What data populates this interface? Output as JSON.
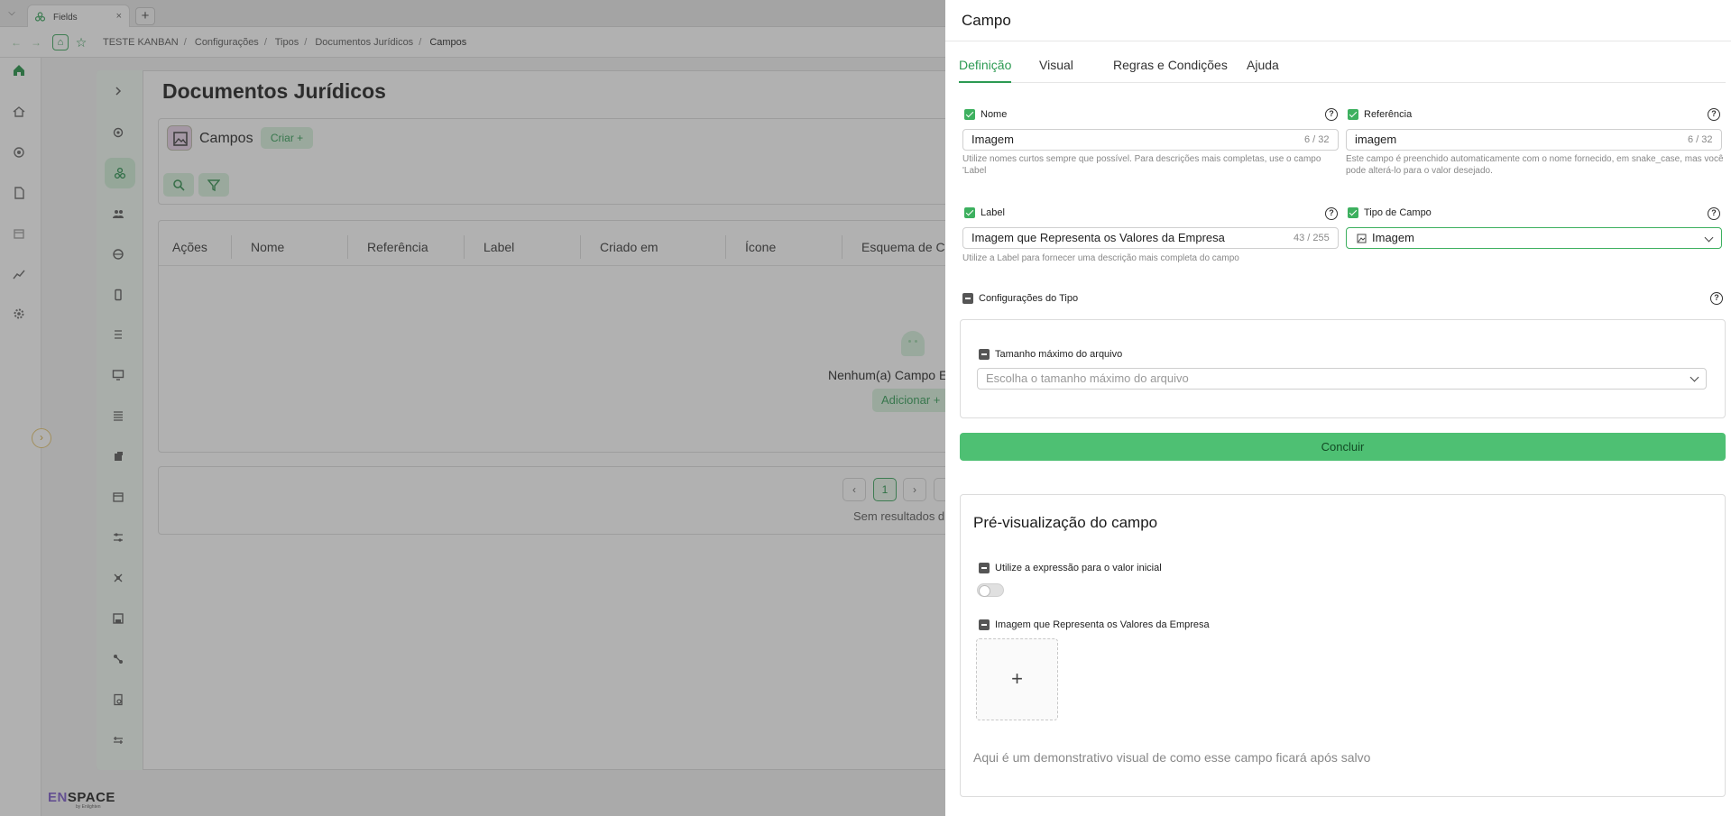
{
  "browser": {
    "tab_title": "Fields",
    "new_tab_symbol": "+",
    "breadcrumb": [
      "TESTE KANBAN",
      "Configurações",
      "Tipos",
      "Documentos Jurídicos",
      "Campos"
    ]
  },
  "app": {
    "rail_icons": [
      "home-icon",
      "house-icon",
      "settings-cog-icon",
      "document-icon",
      "calendar-icon",
      "chart-icon",
      "gear-icon"
    ],
    "brand": {
      "prefix": "EN",
      "suffix": "SPACE",
      "sub": "by Enlighten"
    },
    "accent_color": "#3db05f"
  },
  "page": {
    "title": "Documentos Jurídicos",
    "section_title": "Campos",
    "create_label": "Criar +",
    "inner_rail_icons": [
      "chevron-right-icon",
      "gear-icon",
      "fields-icon",
      "users-icon",
      "globe-icon",
      "phone-icon",
      "list-icon",
      "monitor-icon",
      "menu-icon",
      "stack-icon",
      "calendar-icon",
      "sliders-icon",
      "network-icon",
      "save-icon",
      "connection-icon",
      "report-icon",
      "tools-icon"
    ],
    "table_headers": [
      "Ações",
      "Nome",
      "Referência",
      "Label",
      "Criado em",
      "Ícone",
      "Esquema de C..."
    ],
    "empty_text": "Nenhum(a) Campo Enc",
    "add_label": "Adicionar +",
    "pagination": {
      "current_page": "1",
      "no_results": "Sem resultados d"
    }
  },
  "drawer": {
    "title": "Campo",
    "tabs": [
      "Definição",
      "Visual",
      "Regras e Condições",
      "Ajuda"
    ],
    "active_tab": "Definição",
    "fields": {
      "nome": {
        "label": "Nome",
        "value": "Imagem",
        "counter": "6 / 32",
        "hint": "Utilize nomes curtos sempre que possível. Para descrições mais completas, use o campo 'Label"
      },
      "referencia": {
        "label": "Referência",
        "value": "imagem",
        "counter": "6 / 32",
        "hint": "Este campo é preenchido automaticamente com o nome fornecido, em snake_case, mas você pode alterá-lo para o valor desejado."
      },
      "label": {
        "label": "Label",
        "value": "Imagem que Representa os Valores da Empresa",
        "counter": "43 / 255",
        "hint": "Utilize a Label para fornecer uma descrição mais completa do campo"
      },
      "tipo": {
        "label": "Tipo de Campo",
        "value": "Imagem"
      }
    },
    "type_config": {
      "title": "Configurações do Tipo",
      "max_size_label": "Tamanho máximo do arquivo",
      "max_size_placeholder": "Escolha o tamanho máximo do arquivo"
    },
    "submit_label": "Concluir",
    "preview": {
      "title": "Pré-visualização do campo",
      "expression_label": "Utilize a expressão para o valor inicial",
      "expression_enabled": false,
      "image_field_label": "Imagem que Representa os Valores da Empresa",
      "upload_symbol": "+",
      "description": "Aqui é um demonstrativo visual de como esse campo ficará após salvo"
    }
  }
}
